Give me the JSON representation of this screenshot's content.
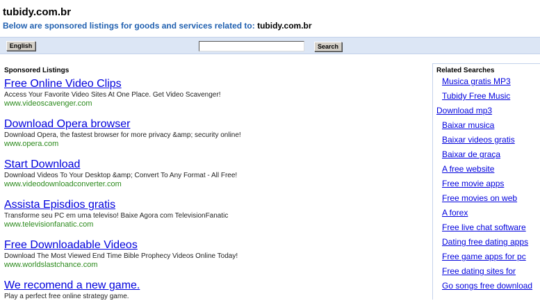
{
  "header": {
    "title": "tubidy.com.br",
    "subtitle_prefix": "Below are sponsored listings for goods and services related to:",
    "subtitle_domain": "tubidy.com.br"
  },
  "toolbar": {
    "language_label": "English",
    "search_value": "",
    "search_label": "Search"
  },
  "sponsored": {
    "title": "Sponsored Listings",
    "listings": [
      {
        "title": "Free Online Video Clips",
        "desc": "Access Your Favorite Video Sites At One Place. Get Video Scavenger!",
        "url": "www.videoscavenger.com"
      },
      {
        "title": "Download Opera browser",
        "desc": "Download Opera, the fastest browser for more privacy &amp; security online!",
        "url": "www.opera.com"
      },
      {
        "title": "Start Download",
        "desc": "Download Videos To Your Desktop &amp; Convert To Any Format - All Free!",
        "url": "www.videodownloadconverter.com"
      },
      {
        "title": "Assista Episdios gratis",
        "desc": "Transforme seu PC em uma televiso! Baixe Agora com TelevisionFanatic",
        "url": "www.televisionfanatic.com"
      },
      {
        "title": "Free Downloadable Videos",
        "desc": "Download The Most Viewed End Time Bible Prophecy Videos Online Today!",
        "url": "www.worldslastchance.com"
      },
      {
        "title": "We recomend a new game.",
        "desc": "Play a perfect free online strategy game.",
        "url": ""
      }
    ]
  },
  "related": {
    "title": "Related Searches",
    "items": [
      "Musica gratis MP3",
      "Tubidy Free Music",
      "Download mp3",
      "Baixar musica",
      "Baixar videos gratis",
      "Baixar de graça",
      "A free website",
      "Free movie apps",
      "Free movies on web",
      "A forex",
      "Free live chat software",
      "Dating free dating apps",
      "Free game apps for pc",
      "Free dating sites for",
      "Go songs free download"
    ]
  }
}
